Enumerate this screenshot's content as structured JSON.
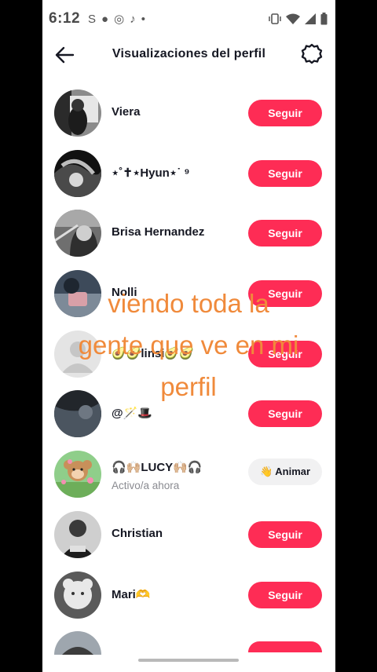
{
  "status_bar": {
    "time": "6:12",
    "app_icons": [
      "S",
      "●",
      "◎",
      "♪",
      "•"
    ]
  },
  "header": {
    "title": "Visualizaciones del perfil",
    "back_icon": "arrow-left-icon",
    "settings_icon": "gear-icon"
  },
  "users": [
    {
      "name": "Viera",
      "action": "Seguir"
    },
    {
      "name": "⋆˚✝︎⋆Hyun⋆˙ ⁹",
      "action": "Seguir"
    },
    {
      "name": "Brisa Hernandez",
      "action": "Seguir"
    },
    {
      "name": "Nolli",
      "action": "Seguir"
    },
    {
      "name": "🥑🥑linsi🥑🥑",
      "action": "Seguir"
    },
    {
      "name": "@🪄🎩",
      "action": "Seguir"
    },
    {
      "name": "🎧🙌🏼LUCY🙌🏼🎧",
      "subtitle": "Activo/a ahora",
      "action": "👋 Animar"
    },
    {
      "name": "Christian",
      "action": "Seguir"
    },
    {
      "name": "Mari🫶",
      "action": "Seguir"
    }
  ],
  "overlay": {
    "line1": "viendo toda la",
    "line2": "gente que ve en mi",
    "line3": "perfil"
  },
  "colors": {
    "accent": "#fe2c55",
    "overlay_text": "#f08a3b"
  }
}
